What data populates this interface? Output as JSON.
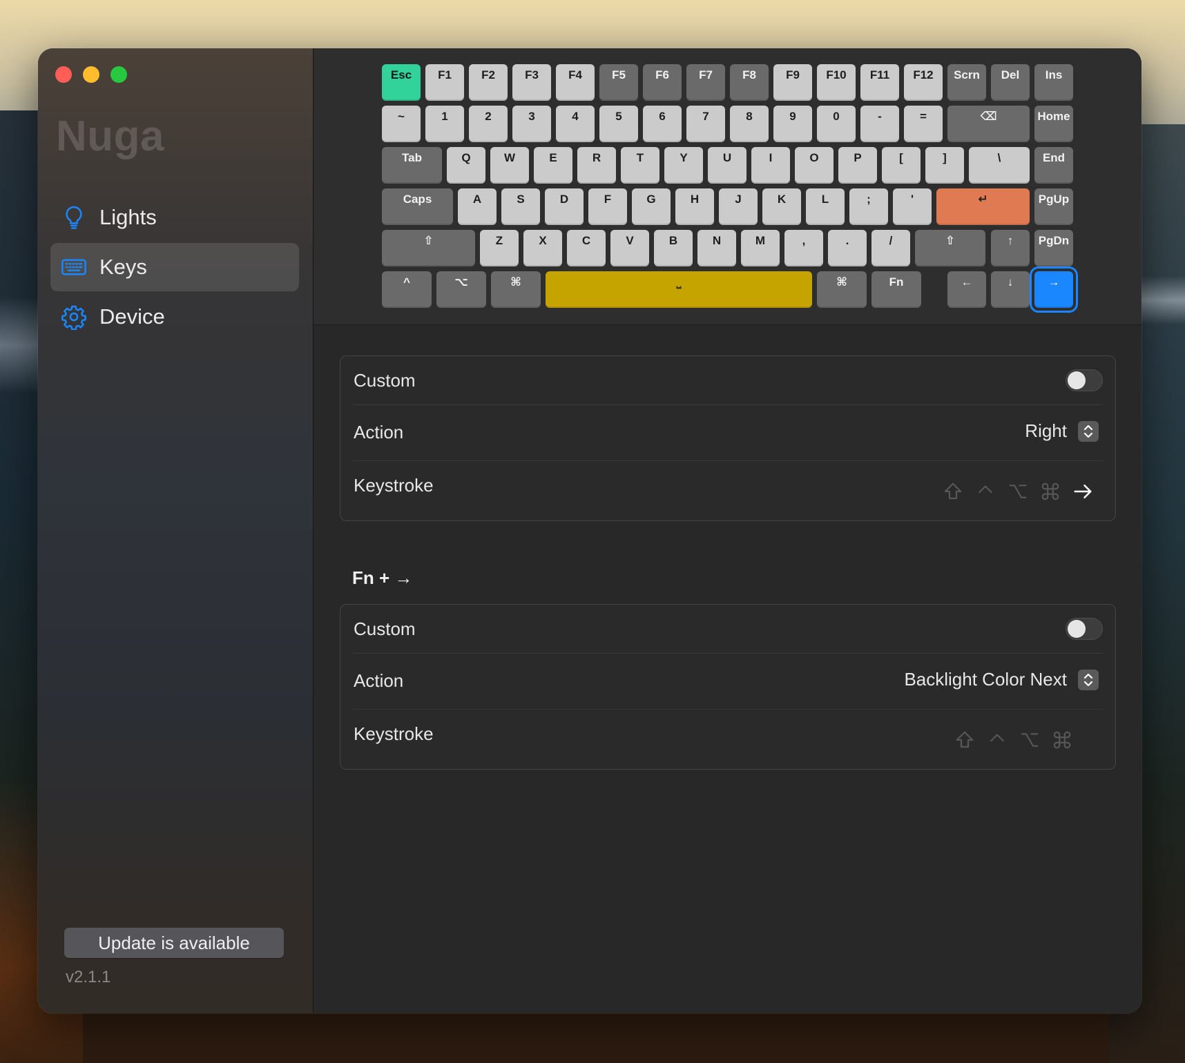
{
  "app": {
    "title": "Nuga",
    "version": "v2.1.1",
    "update_label": "Update is available"
  },
  "sidebar": {
    "items": [
      {
        "label": "Lights",
        "icon": "lightbulb-icon"
      },
      {
        "label": "Keys",
        "icon": "keyboard-icon",
        "active": true
      },
      {
        "label": "Device",
        "icon": "gear-icon"
      }
    ]
  },
  "keyboard": {
    "selected_key": "→",
    "rows": [
      [
        {
          "label": "Esc"
        },
        {
          "label": "F1"
        },
        {
          "label": "F2"
        },
        {
          "label": "F3"
        },
        {
          "label": "F4"
        },
        {
          "label": "F5"
        },
        {
          "label": "F6"
        },
        {
          "label": "F7"
        },
        {
          "label": "F8"
        },
        {
          "label": "F9"
        },
        {
          "label": "F10"
        },
        {
          "label": "F11"
        },
        {
          "label": "F12"
        },
        {
          "label": "Scrn"
        },
        {
          "label": "Del"
        },
        {
          "label": "Ins"
        }
      ],
      [
        {
          "label": "~"
        },
        {
          "label": "1"
        },
        {
          "label": "2"
        },
        {
          "label": "3"
        },
        {
          "label": "4"
        },
        {
          "label": "5"
        },
        {
          "label": "6"
        },
        {
          "label": "7"
        },
        {
          "label": "8"
        },
        {
          "label": "9"
        },
        {
          "label": "0"
        },
        {
          "label": "-"
        },
        {
          "label": "="
        },
        {
          "label": "⌫"
        },
        {
          "label": "Home"
        }
      ],
      [
        {
          "label": "Tab"
        },
        {
          "label": "Q"
        },
        {
          "label": "W"
        },
        {
          "label": "E"
        },
        {
          "label": "R"
        },
        {
          "label": "T"
        },
        {
          "label": "Y"
        },
        {
          "label": "U"
        },
        {
          "label": "I"
        },
        {
          "label": "O"
        },
        {
          "label": "P"
        },
        {
          "label": "["
        },
        {
          "label": "]"
        },
        {
          "label": "\\"
        },
        {
          "label": "End"
        }
      ],
      [
        {
          "label": "Caps"
        },
        {
          "label": "A"
        },
        {
          "label": "S"
        },
        {
          "label": "D"
        },
        {
          "label": "F"
        },
        {
          "label": "G"
        },
        {
          "label": "H"
        },
        {
          "label": "J"
        },
        {
          "label": "K"
        },
        {
          "label": "L"
        },
        {
          "label": ";"
        },
        {
          "label": "'"
        },
        {
          "label": "↵"
        },
        {
          "label": "PgUp"
        }
      ],
      [
        {
          "label": "⇧"
        },
        {
          "label": "Z"
        },
        {
          "label": "X"
        },
        {
          "label": "C"
        },
        {
          "label": "V"
        },
        {
          "label": "B"
        },
        {
          "label": "N"
        },
        {
          "label": "M"
        },
        {
          "label": ","
        },
        {
          "label": "."
        },
        {
          "label": "/"
        },
        {
          "label": "⇧"
        },
        {
          "label": "↑"
        },
        {
          "label": "PgDn"
        }
      ],
      [
        {
          "label": "^"
        },
        {
          "label": "⌥"
        },
        {
          "label": "⌘"
        },
        {
          "label": "⎵"
        },
        {
          "label": "⌘"
        },
        {
          "label": "Fn"
        },
        {
          "label": "←"
        },
        {
          "label": "↓"
        },
        {
          "label": "→"
        }
      ]
    ]
  },
  "key_settings": {
    "custom_label": "Custom",
    "custom_on": false,
    "action_label": "Action",
    "action_value": "Right",
    "keystroke_label": "Keystroke",
    "keystroke_key": "→"
  },
  "fn_settings": {
    "title": "Fn + →",
    "custom_label": "Custom",
    "custom_on": false,
    "action_label": "Action",
    "action_value": "Backlight Color Next",
    "keystroke_label": "Keystroke"
  },
  "colors": {
    "accent": "#1a86ff",
    "esc_key": "#32d29b",
    "enter_key": "#e07a52",
    "space_key": "#c6a400"
  }
}
